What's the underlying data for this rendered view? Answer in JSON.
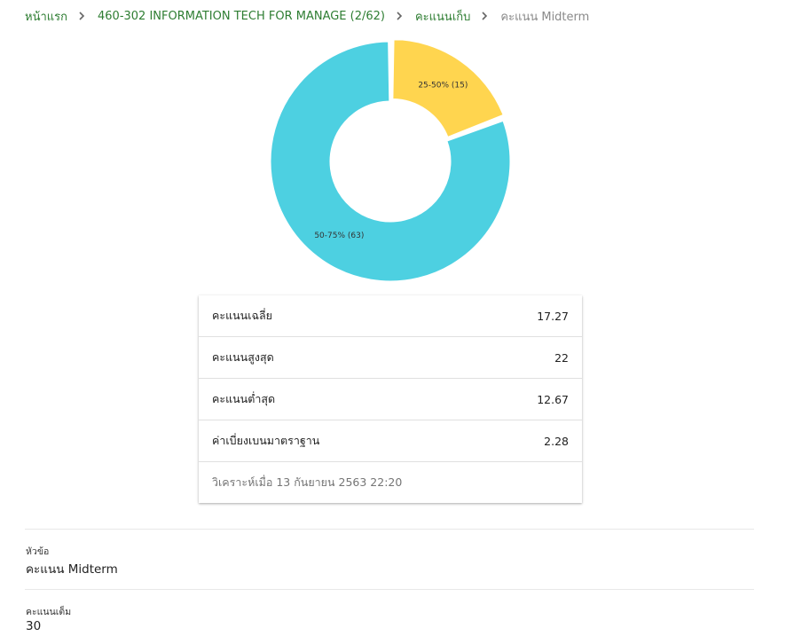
{
  "breadcrumb": {
    "home": "หน้าแรก",
    "course": "460-302 INFORMATION TECH FOR MANAGE (2/62)",
    "scores": "คะแนนเก็บ",
    "current": "คะแนน Midterm"
  },
  "chart_data": {
    "type": "pie",
    "subtype": "donut",
    "slices": [
      {
        "label": "25-50% (15)",
        "value": 15,
        "color": "#ffd54f"
      },
      {
        "label": "50-75% (63)",
        "value": 63,
        "color": "#4dd0e1"
      }
    ],
    "title": "",
    "legend": "none"
  },
  "stats": {
    "rows": [
      {
        "label": "คะแนนเฉลี่ย",
        "value": "17.27"
      },
      {
        "label": "คะแนนสูงสุด",
        "value": "22"
      },
      {
        "label": "คะแนนต่ำสุด",
        "value": "12.67"
      },
      {
        "label": "ค่าเบี่ยงเบนมาตราฐาน",
        "value": "2.28"
      }
    ],
    "analyzed_at": "วิเคราะห์เมื่อ 13 กันยายน 2563 22:20"
  },
  "details": {
    "topic_label": "หัวข้อ",
    "topic_value": "คะแนน Midterm",
    "fullscore_label": "คะแนนเต็ม",
    "fullscore_value": "30"
  }
}
